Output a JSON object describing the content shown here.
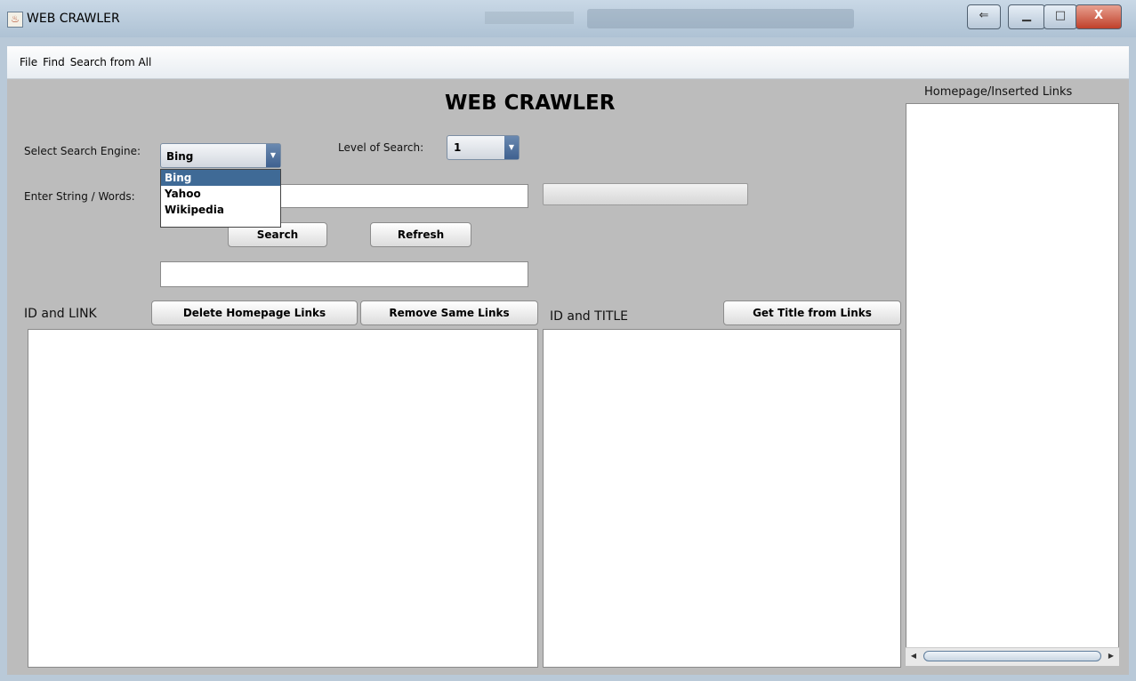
{
  "window": {
    "title": "WEB CRAWLER"
  },
  "menu": [
    "File",
    "Find",
    "Search from All"
  ],
  "main": {
    "heading": "WEB CRAWLER",
    "search_engine_label": "Select Search Engine:",
    "search_engine_selected": "Bing",
    "search_engine_options": [
      "Bing",
      "Yahoo",
      "Wikipedia"
    ],
    "level_label": "Level of Search:",
    "level_selected": "1",
    "string_label": "Enter String / Words:",
    "string_value": "",
    "result_value": "",
    "search_button": "Search",
    "refresh_button": "Refresh",
    "progress_fraction": 0
  },
  "links_panel": {
    "title": "ID and LINK",
    "delete_button": "Delete Homepage Links",
    "remove_button": "Remove Same Links"
  },
  "title_panel": {
    "title": "ID and TITLE",
    "get_title_button": "Get Title from Links"
  },
  "homepage_panel": {
    "title": "Homepage/Inserted Links"
  },
  "icons": {
    "app": "java-coffee-icon",
    "dropdown": "triangle-down-icon"
  }
}
